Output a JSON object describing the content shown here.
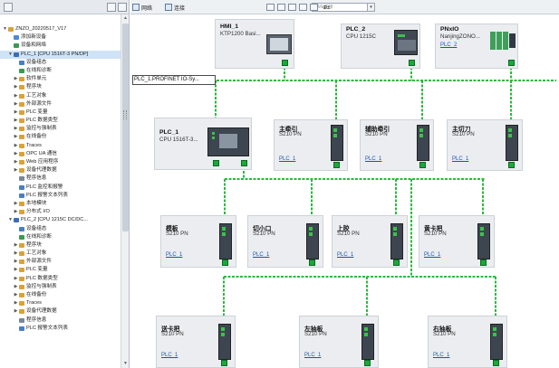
{
  "left_panel": {
    "tree": [
      {
        "label": "ZNZO_20220517_V17",
        "indent": 0,
        "arrow": "▼",
        "icon": "project-icon",
        "color": "#d8a23a"
      },
      {
        "label": "添加新设备",
        "indent": 1,
        "arrow": "",
        "icon": "add-device-icon",
        "color": "#4a8ad8"
      },
      {
        "label": "设备和网络",
        "indent": 1,
        "arrow": "",
        "icon": "network-icon",
        "color": "#3a9a52"
      },
      {
        "label": "PLC_1 [CPU 1516T-3 PN/DP]",
        "indent": 1,
        "arrow": "▼",
        "icon": "plc-icon",
        "color": "#3b6db5",
        "selected": true
      },
      {
        "label": "设备组态",
        "indent": 2,
        "arrow": "",
        "icon": "device-config-icon",
        "color": "#4a7ec2"
      },
      {
        "label": "在线和诊断",
        "indent": 2,
        "arrow": "",
        "icon": "diagnostics-icon",
        "color": "#3a9a52"
      },
      {
        "label": "软件单元",
        "indent": 2,
        "arrow": "▶",
        "icon": "folder-icon",
        "color": "#d8a23a"
      },
      {
        "label": "程序块",
        "indent": 2,
        "arrow": "▶",
        "icon": "folder-icon",
        "color": "#d8a23a"
      },
      {
        "label": "工艺对象",
        "indent": 2,
        "arrow": "▶",
        "icon": "folder-icon",
        "color": "#d8a23a"
      },
      {
        "label": "外部源文件",
        "indent": 2,
        "arrow": "▶",
        "icon": "folder-icon",
        "color": "#d8a23a"
      },
      {
        "label": "PLC 变量",
        "indent": 2,
        "arrow": "▶",
        "icon": "folder-icon",
        "color": "#d8a23a"
      },
      {
        "label": "PLC 数据类型",
        "indent": 2,
        "arrow": "▶",
        "icon": "folder-icon",
        "color": "#d8a23a"
      },
      {
        "label": "监控与强制表",
        "indent": 2,
        "arrow": "▶",
        "icon": "folder-icon",
        "color": "#d8a23a"
      },
      {
        "label": "在线备份",
        "indent": 2,
        "arrow": "▶",
        "icon": "folder-icon",
        "color": "#d8a23a"
      },
      {
        "label": "Traces",
        "indent": 2,
        "arrow": "▶",
        "icon": "folder-icon",
        "color": "#d8a23a"
      },
      {
        "label": "OPC UA 通信",
        "indent": 2,
        "arrow": "▶",
        "icon": "folder-icon",
        "color": "#d8a23a"
      },
      {
        "label": "Web 应用程序",
        "indent": 2,
        "arrow": "▶",
        "icon": "folder-icon",
        "color": "#d8a23a"
      },
      {
        "label": "设备代理数据",
        "indent": 2,
        "arrow": "▶",
        "icon": "folder-icon",
        "color": "#d8a23a"
      },
      {
        "label": "程序信息",
        "indent": 2,
        "arrow": "",
        "icon": "program-info-icon",
        "color": "#7a8796"
      },
      {
        "label": "PLC 监控和报警",
        "indent": 2,
        "arrow": "",
        "icon": "alarm-icon",
        "color": "#4a7ec2"
      },
      {
        "label": "PLC 报警文本列表",
        "indent": 2,
        "arrow": "",
        "icon": "alarm-text-icon",
        "color": "#4a7ec2"
      },
      {
        "label": "本地模块",
        "indent": 2,
        "arrow": "▶",
        "icon": "folder-icon",
        "color": "#d8a23a"
      },
      {
        "label": "分布式 I/O",
        "indent": 2,
        "arrow": "▶",
        "icon": "folder-icon",
        "color": "#d8a23a"
      },
      {
        "label": "PLC_2 [CPU 1215C DC/DC...",
        "indent": 1,
        "arrow": "▼",
        "icon": "plc-icon",
        "color": "#3b6db5"
      },
      {
        "label": "设备组态",
        "indent": 2,
        "arrow": "",
        "icon": "device-config-icon",
        "color": "#4a7ec2"
      },
      {
        "label": "在线和诊断",
        "indent": 2,
        "arrow": "",
        "icon": "diagnostics-icon",
        "color": "#3a9a52"
      },
      {
        "label": "程序块",
        "indent": 2,
        "arrow": "▶",
        "icon": "folder-icon",
        "color": "#d8a23a"
      },
      {
        "label": "工艺对象",
        "indent": 2,
        "arrow": "▶",
        "icon": "folder-icon",
        "color": "#d8a23a"
      },
      {
        "label": "外部源文件",
        "indent": 2,
        "arrow": "▶",
        "icon": "folder-icon",
        "color": "#d8a23a"
      },
      {
        "label": "PLC 变量",
        "indent": 2,
        "arrow": "▶",
        "icon": "folder-icon",
        "color": "#d8a23a"
      },
      {
        "label": "PLC 数据类型",
        "indent": 2,
        "arrow": "▶",
        "icon": "folder-icon",
        "color": "#d8a23a"
      },
      {
        "label": "监控与强制表",
        "indent": 2,
        "arrow": "▶",
        "icon": "folder-icon",
        "color": "#d8a23a"
      },
      {
        "label": "在线备份",
        "indent": 2,
        "arrow": "▶",
        "icon": "folder-icon",
        "color": "#d8a23a"
      },
      {
        "label": "Traces",
        "indent": 2,
        "arrow": "▶",
        "icon": "folder-icon",
        "color": "#d8a23a"
      },
      {
        "label": "设备代理数据",
        "indent": 2,
        "arrow": "▶",
        "icon": "folder-icon",
        "color": "#d8a23a"
      },
      {
        "label": "程序信息",
        "indent": 2,
        "arrow": "",
        "icon": "program-info-icon",
        "color": "#7a8796"
      },
      {
        "label": "PLC 报警文本列表",
        "indent": 2,
        "arrow": "",
        "icon": "alarm-text-icon",
        "color": "#4a7ec2"
      }
    ]
  },
  "toolbar": {
    "network_label": "网络",
    "connection_label": "连接",
    "hmi_placeholder": "HMI 连接",
    "dropdown_glyph": "▾",
    "zoom_glyph": "⊕±"
  },
  "network": {
    "label": "PLC_1.PROFINET IO-Sy...",
    "wire_color": "#2db83d"
  },
  "devices": {
    "hmi": {
      "name": "HMI_1",
      "type": "KTP1200 Basi..."
    },
    "plc2": {
      "name": "PLC_2",
      "type": "CPU 1215C"
    },
    "pnxio": {
      "name": "PNxIO",
      "type": "NanjingZONO...",
      "link": "PLC_2"
    },
    "plc1": {
      "name": "PLC_1",
      "type": "CPU 1516T-3..."
    },
    "d1": {
      "name": "主牵引",
      "type": "S210 PN",
      "link": "PLC_1"
    },
    "d2": {
      "name": "辅助牵引",
      "type": "S210 PN",
      "link": "PLC_1"
    },
    "d3": {
      "name": "主切刀",
      "type": "S210 PN",
      "link": "PLC_1"
    },
    "d4": {
      "name": "模板",
      "type": "S210 PN",
      "link": "PLC_1"
    },
    "d5": {
      "name": "切小口",
      "type": "S210 PN",
      "link": "PLC_1"
    },
    "d6": {
      "name": "上胶",
      "type": "S210 PN",
      "link": "PLC_1"
    },
    "d7": {
      "name": "黄卡把",
      "type": "S210 PN",
      "link": "PLC_1"
    },
    "d8": {
      "name": "送卡把",
      "type": "S210 PN",
      "link": "PLC_1"
    },
    "d9": {
      "name": "左抽板",
      "type": "S210 PN",
      "link": "PLC_1"
    },
    "d10": {
      "name": "右抽板",
      "type": "S210 PN",
      "link": "PLC_1"
    }
  }
}
